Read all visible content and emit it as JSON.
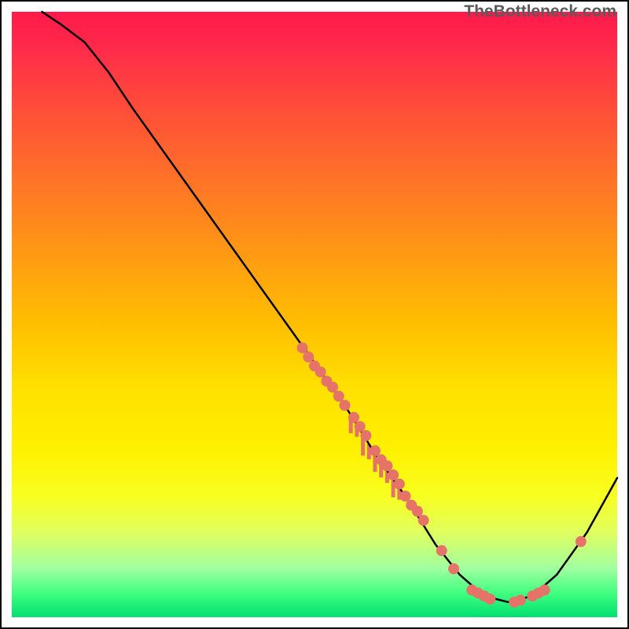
{
  "watermark": "TheBottleneck.com",
  "chart_data": {
    "type": "line",
    "title": "",
    "xlabel": "",
    "ylabel": "",
    "xlim": [
      0,
      100
    ],
    "ylim": [
      0,
      100
    ],
    "grid": false,
    "curve": [
      {
        "x": 5,
        "y": 100
      },
      {
        "x": 8,
        "y": 98
      },
      {
        "x": 12,
        "y": 95
      },
      {
        "x": 16,
        "y": 90
      },
      {
        "x": 20,
        "y": 84
      },
      {
        "x": 30,
        "y": 70
      },
      {
        "x": 40,
        "y": 56
      },
      {
        "x": 50,
        "y": 42
      },
      {
        "x": 55,
        "y": 35
      },
      {
        "x": 60,
        "y": 27
      },
      {
        "x": 65,
        "y": 20
      },
      {
        "x": 70,
        "y": 12
      },
      {
        "x": 74,
        "y": 7
      },
      {
        "x": 78,
        "y": 3.5
      },
      {
        "x": 82,
        "y": 2.5
      },
      {
        "x": 86,
        "y": 3.5
      },
      {
        "x": 90,
        "y": 7
      },
      {
        "x": 95,
        "y": 14
      },
      {
        "x": 100,
        "y": 23
      }
    ],
    "points_scatter": [
      {
        "x": 48,
        "y": 44.5
      },
      {
        "x": 49,
        "y": 43
      },
      {
        "x": 50,
        "y": 41.5
      },
      {
        "x": 51,
        "y": 40.5
      },
      {
        "x": 52,
        "y": 39
      },
      {
        "x": 53,
        "y": 38
      },
      {
        "x": 54,
        "y": 36.5
      },
      {
        "x": 55,
        "y": 35
      },
      {
        "x": 56.5,
        "y": 33
      },
      {
        "x": 57.5,
        "y": 31.5
      },
      {
        "x": 58.5,
        "y": 30
      },
      {
        "x": 60,
        "y": 27.5
      },
      {
        "x": 61,
        "y": 26
      },
      {
        "x": 62,
        "y": 25
      },
      {
        "x": 63,
        "y": 23.5
      },
      {
        "x": 64,
        "y": 22
      },
      {
        "x": 65,
        "y": 20
      },
      {
        "x": 66,
        "y": 18.5
      },
      {
        "x": 67,
        "y": 17.5
      },
      {
        "x": 68,
        "y": 16
      },
      {
        "x": 71,
        "y": 11
      },
      {
        "x": 73,
        "y": 8
      },
      {
        "x": 76,
        "y": 4.5
      },
      {
        "x": 77,
        "y": 4.0
      },
      {
        "x": 78,
        "y": 3.5
      },
      {
        "x": 79,
        "y": 3.0
      },
      {
        "x": 83,
        "y": 2.5
      },
      {
        "x": 84,
        "y": 2.8
      },
      {
        "x": 86,
        "y": 3.5
      },
      {
        "x": 87,
        "y": 4.0
      },
      {
        "x": 88,
        "y": 4.5
      },
      {
        "x": 94,
        "y": 12.5
      }
    ],
    "drip_bars": [
      {
        "x": 56,
        "len": 3
      },
      {
        "x": 57,
        "len": 2
      },
      {
        "x": 58,
        "len": 3.5
      },
      {
        "x": 59,
        "len": 2.5
      },
      {
        "x": 60,
        "len": 3
      },
      {
        "x": 61,
        "len": 2.5
      },
      {
        "x": 62,
        "len": 2
      },
      {
        "x": 63,
        "len": 3
      },
      {
        "x": 64,
        "len": 2
      }
    ],
    "colors": {
      "curve": "#000000",
      "dots": "#e57368"
    }
  }
}
